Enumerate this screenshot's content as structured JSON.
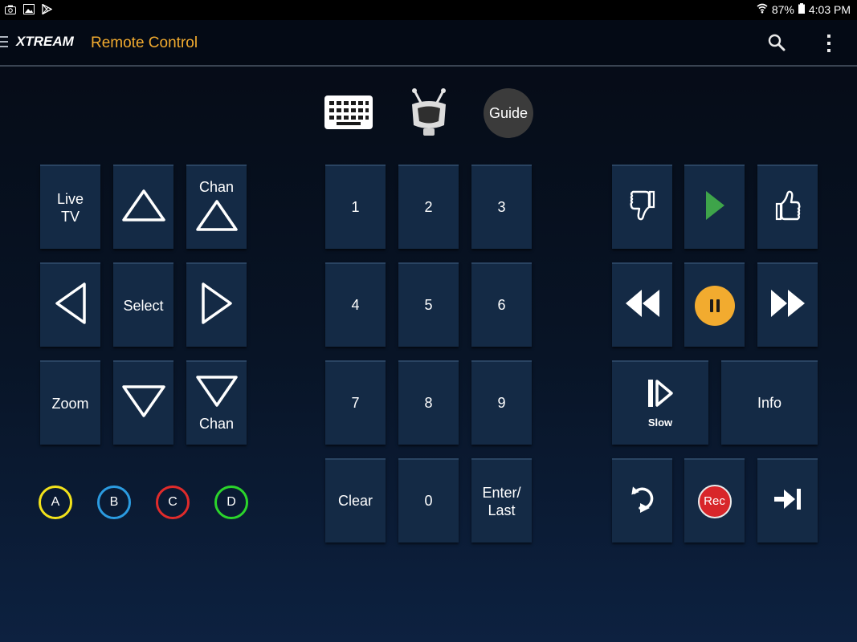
{
  "status_bar": {
    "battery": "87%",
    "time": "4:03 PM",
    "notification_icons": [
      "screenshot-icon",
      "image-icon",
      "play-store-icon"
    ]
  },
  "app_bar": {
    "logo": "XTREAM",
    "title": "Remote Control",
    "title_color": "#f2ab2f",
    "actions": [
      "search-icon",
      "overflow-menu-icon"
    ]
  },
  "top_row": {
    "keyboard": "keyboard-icon",
    "tivo": "tivo-icon",
    "guide_label": "Guide"
  },
  "nav_pad": {
    "live_tv": "Live\nTV",
    "chan_up": "Chan",
    "select": "Select",
    "zoom": "Zoom",
    "chan_down": "Chan"
  },
  "color_buttons": [
    {
      "label": "A",
      "color": "#f2e21b"
    },
    {
      "label": "B",
      "color": "#2b9be0"
    },
    {
      "label": "C",
      "color": "#e02b2b"
    },
    {
      "label": "D",
      "color": "#2bd42b"
    }
  ],
  "numpad": {
    "keys": [
      "1",
      "2",
      "3",
      "4",
      "5",
      "6",
      "7",
      "8",
      "9"
    ],
    "clear": "Clear",
    "zero": "0",
    "enter": "Enter/\nLast"
  },
  "transport": {
    "slow": "Slow",
    "info": "Info",
    "rec": "Rec",
    "play_color": "#3ea44a",
    "pause_color": "#f2ab2f",
    "rec_color": "#d8262a"
  }
}
